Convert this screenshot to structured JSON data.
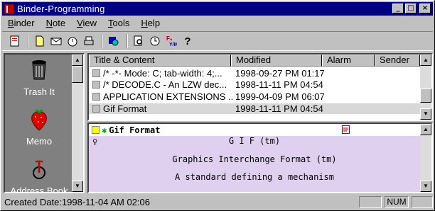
{
  "window": {
    "title": "Binder-Programming"
  },
  "menu": [
    "Binder",
    "Note",
    "View",
    "Tools",
    "Help"
  ],
  "menu_underline": [
    "B",
    "N",
    "V",
    "T",
    "H"
  ],
  "toolbar_icons": [
    "new-note-icon",
    "note-icon",
    "mail-icon",
    "timer-icon",
    "print-icon",
    "refresh-icon",
    "find-icon",
    "clock-icon",
    "format-icon",
    "help-icon"
  ],
  "sidebar": {
    "items": [
      {
        "label": "Trash It",
        "icon": "trash-can-icon"
      },
      {
        "label": "Memo",
        "icon": "strawberry-icon"
      },
      {
        "label": "Address Book",
        "icon": "bicycle-icon"
      }
    ]
  },
  "list": {
    "columns": [
      "Title & Content",
      "Modified",
      "Alarm",
      "Sender"
    ],
    "rows": [
      {
        "title": "/* -*- Mode: C; tab-width: 4;...",
        "modified": "1998-09-27 PM 01:17"
      },
      {
        "title": "/* DECODE.C - An LZW dec...",
        "modified": "1998-11-11 PM 04:54"
      },
      {
        "title": "APPLICATION EXTENSIONS ...",
        "modified": "1999-04-09 PM 06:07"
      },
      {
        "title": "Gif Format",
        "modified": "1998-11-11 PM 04:54"
      }
    ],
    "selected_index": 3
  },
  "note": {
    "title": "Gif Format",
    "lines": [
      "G I F (tm)",
      "Graphics Interchange Format (tm)",
      "A standard defining a mechanism"
    ]
  },
  "status": {
    "created": "Created Date:1998-11-04 AM 02:06",
    "num": "NUM"
  },
  "colors": {
    "titlebar": "#000080",
    "note_bg": "#e0d0f0",
    "sidebar_bg": "#808080"
  }
}
